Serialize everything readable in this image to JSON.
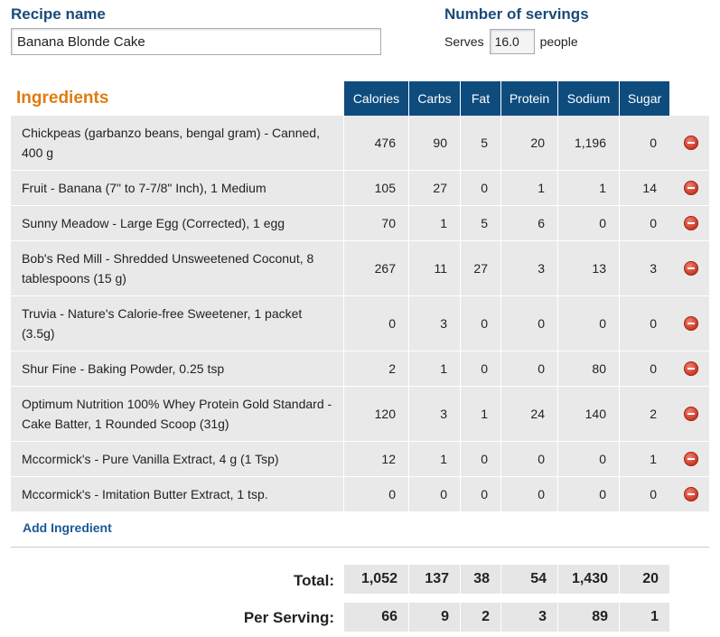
{
  "recipe": {
    "label": "Recipe name",
    "value": "Banana Blonde Cake"
  },
  "servings": {
    "label": "Number of servings",
    "prefix": "Serves",
    "value": "16.0",
    "suffix": "people"
  },
  "ingredients_title": "Ingredients",
  "columns": [
    "Calories",
    "Carbs",
    "Fat",
    "Protein",
    "Sodium",
    "Sugar"
  ],
  "rows": [
    {
      "name": "Chickpeas (garbanzo beans, bengal gram) - Canned, 400 g",
      "values": [
        "476",
        "90",
        "5",
        "20",
        "1,196",
        "0"
      ]
    },
    {
      "name": "Fruit - Banana (7\" to 7-7/8\" Inch), 1 Medium",
      "values": [
        "105",
        "27",
        "0",
        "1",
        "1",
        "14"
      ]
    },
    {
      "name": "Sunny Meadow - Large Egg (Corrected), 1 egg",
      "values": [
        "70",
        "1",
        "5",
        "6",
        "0",
        "0"
      ]
    },
    {
      "name": "Bob's Red Mill - Shredded Unsweetened Coconut, 8 tablespoons (15 g)",
      "values": [
        "267",
        "11",
        "27",
        "3",
        "13",
        "3"
      ]
    },
    {
      "name": "Truvia - Nature's Calorie-free Sweetener, 1 packet (3.5g)",
      "values": [
        "0",
        "3",
        "0",
        "0",
        "0",
        "0"
      ]
    },
    {
      "name": "Shur Fine - Baking Powder, 0.25 tsp",
      "values": [
        "2",
        "1",
        "0",
        "0",
        "80",
        "0"
      ]
    },
    {
      "name": "Optimum Nutrition 100% Whey Protein Gold Standard - Cake Batter, 1 Rounded Scoop (31g)",
      "values": [
        "120",
        "3",
        "1",
        "24",
        "140",
        "2"
      ]
    },
    {
      "name": "Mccormick's - Pure Vanilla Extract, 4 g (1 Tsp)",
      "values": [
        "12",
        "1",
        "0",
        "0",
        "0",
        "1"
      ]
    },
    {
      "name": "Mccormick's - Imitation Butter Extract, 1 tsp.",
      "values": [
        "0",
        "0",
        "0",
        "0",
        "0",
        "0"
      ]
    }
  ],
  "add_ingredient": "Add Ingredient",
  "totals": {
    "label": "Total:",
    "values": [
      "1,052",
      "137",
      "38",
      "54",
      "1,430",
      "20"
    ]
  },
  "per_serving": {
    "label": "Per Serving:",
    "values": [
      "66",
      "9",
      "2",
      "3",
      "89",
      "1"
    ]
  },
  "colors": {
    "header_bg": "#0f4c7e",
    "accent_orange": "#e07c10",
    "label_blue": "#1a4a7a",
    "remove_red": "#c2331e"
  }
}
